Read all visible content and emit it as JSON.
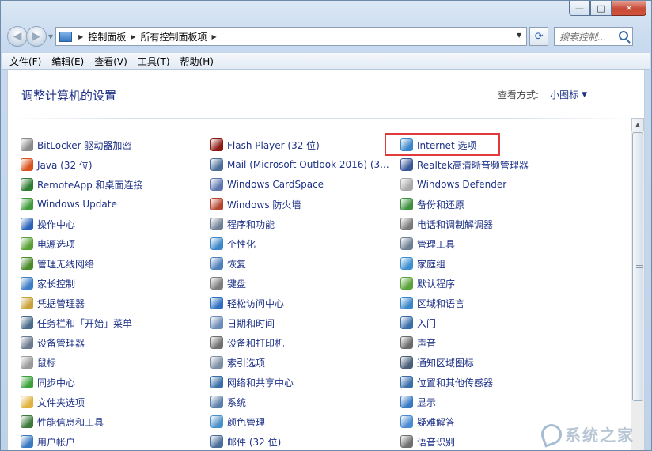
{
  "window": {
    "caption": {
      "minimize": "—",
      "maximize": "□",
      "close": "✕"
    }
  },
  "nav": {
    "back_glyph": "◀",
    "forward_glyph": "▶",
    "breadcrumb": [
      "控制面板",
      "所有控制面板项"
    ],
    "refresh_glyph": "⟳",
    "search_placeholder": "搜索控制..."
  },
  "menu": [
    "文件(F)",
    "编辑(E)",
    "查看(V)",
    "工具(T)",
    "帮助(H)"
  ],
  "main": {
    "heading": "调整计算机的设置",
    "view_by_label": "查看方式:",
    "view_by_value": "小图标",
    "view_by_arrow": "▼"
  },
  "items": {
    "col1": [
      {
        "label": "BitLocker 驱动器加密",
        "icon": "bitlocker-icon",
        "color": "#8a8a8a"
      },
      {
        "label": "Java (32 位)",
        "icon": "java-icon",
        "color": "#d9531e"
      },
      {
        "label": "RemoteApp 和桌面连接",
        "icon": "remoteapp-icon",
        "color": "#2e7d32"
      },
      {
        "label": "Windows Update",
        "icon": "windows-update-icon",
        "color": "#3e9a3a"
      },
      {
        "label": "操作中心",
        "icon": "action-center-flag-icon",
        "color": "#2a62b8"
      },
      {
        "label": "电源选项",
        "icon": "power-options-icon",
        "color": "#58a035"
      },
      {
        "label": "管理无线网络",
        "icon": "wireless-network-icon",
        "color": "#4a8a2a"
      },
      {
        "label": "家长控制",
        "icon": "parental-controls-icon",
        "color": "#3f7ec6"
      },
      {
        "label": "凭据管理器",
        "icon": "credential-manager-icon",
        "color": "#c9a23a"
      },
      {
        "label": "任务栏和「开始」菜单",
        "icon": "taskbar-icon",
        "color": "#4a6b8a"
      },
      {
        "label": "设备管理器",
        "icon": "device-manager-icon",
        "color": "#6b7a8c"
      },
      {
        "label": "鼠标",
        "icon": "mouse-icon",
        "color": "#9a9a9a"
      },
      {
        "label": "同步中心",
        "icon": "sync-center-icon",
        "color": "#3ba23b"
      },
      {
        "label": "文件夹选项",
        "icon": "folder-options-icon",
        "color": "#e0b13c"
      },
      {
        "label": "性能信息和工具",
        "icon": "performance-icon",
        "color": "#3b7a3b"
      },
      {
        "label": "用户帐户",
        "icon": "user-accounts-icon",
        "color": "#3a78c2"
      }
    ],
    "col2": [
      {
        "label": "Flash Player (32 位)",
        "icon": "flash-player-icon",
        "color": "#8a1a12"
      },
      {
        "label": "Mail (Microsoft Outlook 2016) (3...",
        "icon": "mail-icon",
        "color": "#4a6d99"
      },
      {
        "label": "Windows CardSpace",
        "icon": "cardspace-icon",
        "color": "#5e76b0"
      },
      {
        "label": "Windows 防火墙",
        "icon": "firewall-icon",
        "color": "#b5452e"
      },
      {
        "label": "程序和功能",
        "icon": "programs-icon",
        "color": "#6e7f93"
      },
      {
        "label": "个性化",
        "icon": "personalization-icon",
        "color": "#3a86c8"
      },
      {
        "label": "恢复",
        "icon": "recovery-icon",
        "color": "#4d7fb8"
      },
      {
        "label": "键盘",
        "icon": "keyboard-icon",
        "color": "#7d7d7d"
      },
      {
        "label": "轻松访问中心",
        "icon": "ease-of-access-icon",
        "color": "#2e6fc0"
      },
      {
        "label": "日期和时间",
        "icon": "date-time-icon",
        "color": "#6b8bb8"
      },
      {
        "label": "设备和打印机",
        "icon": "devices-printers-icon",
        "color": "#6f6f6f"
      },
      {
        "label": "索引选项",
        "icon": "indexing-icon",
        "color": "#7c8ea3"
      },
      {
        "label": "网络和共享中心",
        "icon": "network-sharing-icon",
        "color": "#3a6ea8"
      },
      {
        "label": "系统",
        "icon": "system-icon",
        "color": "#5a7fa8"
      },
      {
        "label": "颜色管理",
        "icon": "color-management-icon",
        "color": "#4a90c8"
      },
      {
        "label": "邮件 (32 位)",
        "icon": "mail-32-icon",
        "color": "#4a6d99"
      }
    ],
    "col3": [
      {
        "label": "Internet 选项",
        "icon": "internet-options-icon",
        "color": "#3a86c8"
      },
      {
        "label": "Realtek高清晰音频管理器",
        "icon": "realtek-icon",
        "color": "#3b5998"
      },
      {
        "label": "Windows Defender",
        "icon": "defender-icon",
        "color": "#a9a9a9"
      },
      {
        "label": "备份和还原",
        "icon": "backup-icon",
        "color": "#3e8f3e"
      },
      {
        "label": "电话和调制解调器",
        "icon": "phone-modem-icon",
        "color": "#7a7a7a"
      },
      {
        "label": "管理工具",
        "icon": "admin-tools-icon",
        "color": "#6e7f93"
      },
      {
        "label": "家庭组",
        "icon": "homegroup-icon",
        "color": "#3d8fd1"
      },
      {
        "label": "默认程序",
        "icon": "default-programs-icon",
        "color": "#5aa33a"
      },
      {
        "label": "区域和语言",
        "icon": "region-language-icon",
        "color": "#3a86c8"
      },
      {
        "label": "入门",
        "icon": "getting-started-icon",
        "color": "#3a6ea8"
      },
      {
        "label": "声音",
        "icon": "sound-icon",
        "color": "#6a6a6a"
      },
      {
        "label": "通知区域图标",
        "icon": "notification-area-icon",
        "color": "#4a5f78"
      },
      {
        "label": "位置和其他传感器",
        "icon": "location-sensors-icon",
        "color": "#3a6ea8"
      },
      {
        "label": "显示",
        "icon": "display-icon",
        "color": "#3a78c2"
      },
      {
        "label": "疑难解答",
        "icon": "troubleshooting-icon",
        "color": "#4a8ad0"
      },
      {
        "label": "语音识别",
        "icon": "speech-icon",
        "color": "#6f6f6f"
      }
    ]
  },
  "highlight_color": "#e03a3a",
  "watermark": "系统之家"
}
